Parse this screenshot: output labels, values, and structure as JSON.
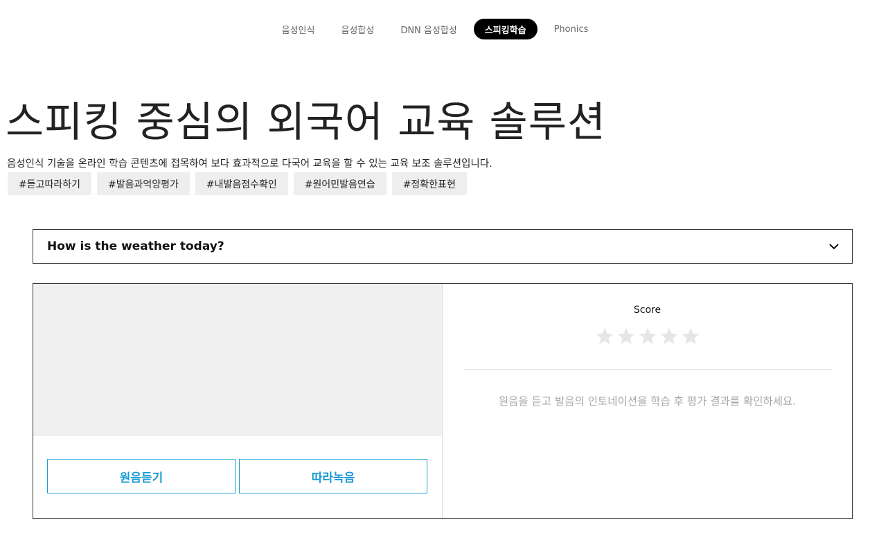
{
  "nav": {
    "items": [
      {
        "label": "음성인식"
      },
      {
        "label": "음성합성"
      },
      {
        "label": "DNN 음성합성"
      },
      {
        "label": "스피킹학습"
      },
      {
        "label": "Phonics"
      }
    ],
    "active_index": 3
  },
  "hero": {
    "title": "스피킹 중심의 외국어 교육 솔루션",
    "description": "음성인식 기술을 온라인 학습 콘텐츠에 접목하여 보다 효과적으로 다국어 교육을 할 수 있는 교육 보조 솔루션입니다.",
    "tags": [
      "#듣고따라하기",
      "#발음과억양평가",
      "#내발음점수확인",
      "#원어민발음연습",
      "#정확한표현"
    ]
  },
  "sentence_select": {
    "selected": "How is the weather today?",
    "icon": "chevron-down-icon"
  },
  "practice": {
    "listen_button": "원음듣기",
    "record_button": "따라녹음",
    "score_label": "Score",
    "stars_total": 5,
    "stars_filled": 0,
    "hint": "원음을 듣고 발음의 인토네이션을 학습 후 평가 결과를 확인하세요."
  },
  "colors": {
    "accent": "#1a9ad6",
    "nav_active_bg": "#000000",
    "tag_bg": "#eeeeee",
    "video_bg": "#f0f0f0",
    "star_empty": "#e6e6e6",
    "hint_text": "#a6a6a6"
  }
}
